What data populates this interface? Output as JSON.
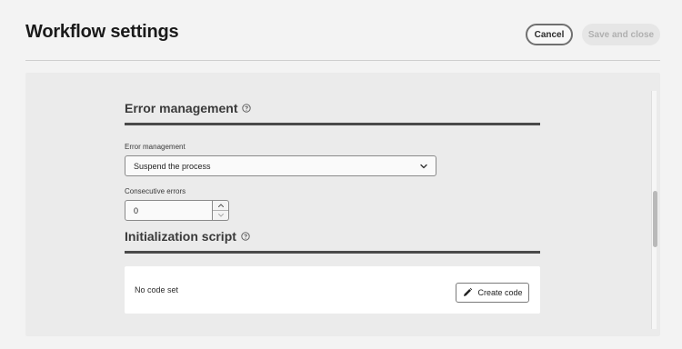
{
  "header": {
    "title": "Workflow settings",
    "cancel_label": "Cancel",
    "save_label": "Save and close"
  },
  "error_section": {
    "title": "Error management",
    "help_icon": "help-circle-icon",
    "field_label": "Error management",
    "selected_value": "Suspend the process",
    "consecutive_label": "Consecutive errors",
    "consecutive_value": "0"
  },
  "init_section": {
    "title": "Initialization script",
    "help_icon": "help-circle-icon",
    "empty_text": "No code set",
    "create_label": "Create code",
    "create_icon": "pencil-icon"
  },
  "colors": {
    "background": "#f3f3f3",
    "panel": "#ebebeb",
    "rule": "#4a4a4a",
    "disabled_button": "#e6e6e6"
  }
}
